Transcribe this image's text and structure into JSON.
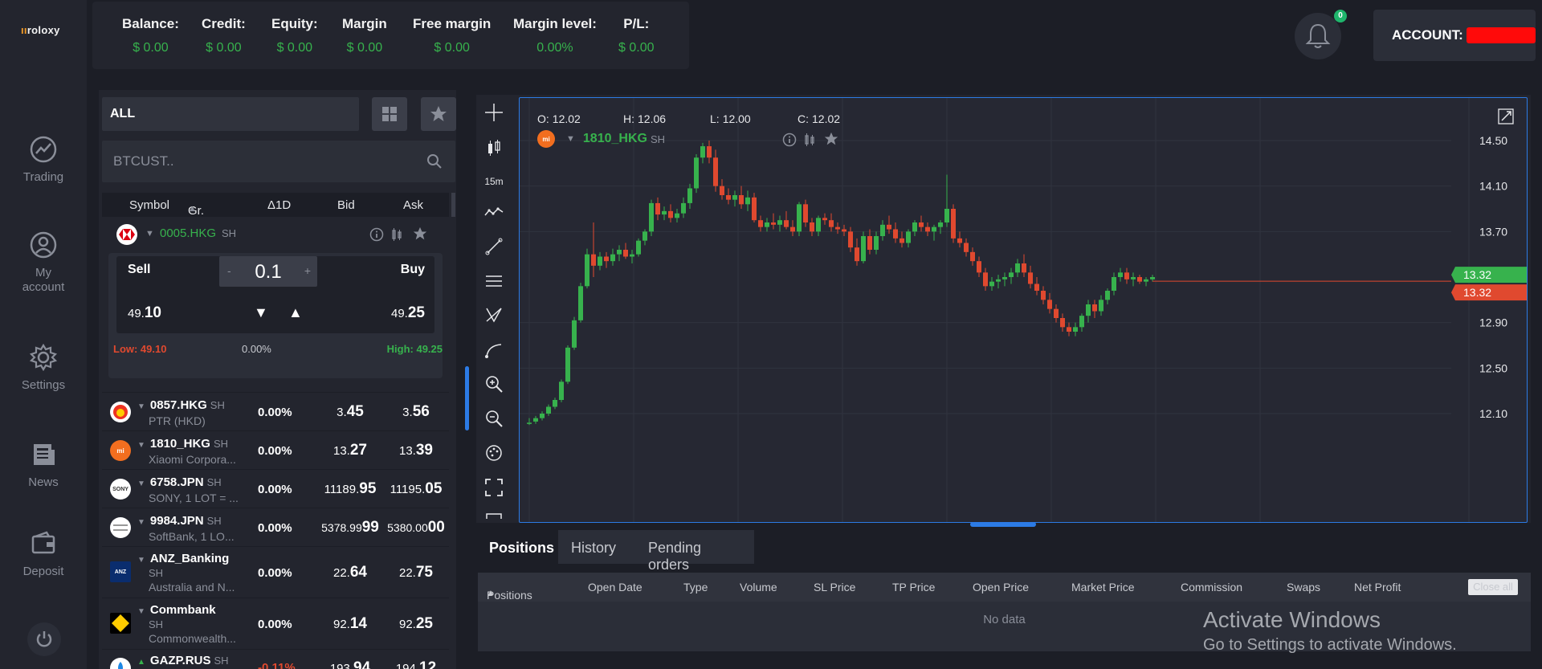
{
  "app": {
    "logo_text": "roloxy"
  },
  "nav": [
    {
      "label": "Trading",
      "icon": "trading-icon"
    },
    {
      "label": "My account",
      "icon": "user-icon"
    },
    {
      "label": "Settings",
      "icon": "gear-icon"
    },
    {
      "label": "News",
      "icon": "news-icon"
    },
    {
      "label": "Deposit",
      "icon": "wallet-icon"
    }
  ],
  "stats": [
    {
      "label": "Balance:",
      "value": "$ 0.00"
    },
    {
      "label": "Credit:",
      "value": "$ 0.00"
    },
    {
      "label": "Equity:",
      "value": "$ 0.00"
    },
    {
      "label": "Margin",
      "value": "$ 0.00"
    },
    {
      "label": "Free margin",
      "value": "$ 0.00"
    },
    {
      "label": "Margin level:",
      "value": "0.00%"
    },
    {
      "label": "P/L:",
      "value": "$ 0.00"
    }
  ],
  "notifications": {
    "count": "0"
  },
  "account": {
    "label": "ACCOUNT:"
  },
  "watchlist": {
    "filter": "ALL",
    "search_placeholder": "BTCUST..",
    "columns": {
      "symbol": "Symbol",
      "group": "Gr.",
      "change": "Δ1D",
      "bid": "Bid",
      "ask": "Ask"
    },
    "expanded": {
      "symbol": "0005.HKG",
      "tag": "SH",
      "sell_label": "Sell",
      "buy_label": "Buy",
      "lot": "0.1",
      "minus": "-",
      "plus": "+",
      "sell_small": "49.",
      "sell_big": "10",
      "buy_small": "49.",
      "buy_big": "25",
      "low": "Low: 49.10",
      "change": "0.00%",
      "high": "High: 49.25"
    },
    "rows": [
      {
        "symbol": "0857.HKG",
        "tag": "SH",
        "desc": "PTR (HKD)",
        "change": "0.00%",
        "bid_small": "3.",
        "bid_big": "45",
        "ask_small": "3.",
        "ask_big": "56",
        "logo": ""
      },
      {
        "symbol": "1810_HKG",
        "tag": "SH",
        "desc": "Xiaomi Corpora...",
        "change": "0.00%",
        "bid_small": "13.",
        "bid_big": "27",
        "ask_small": "13.",
        "ask_big": "39",
        "logo": "mi"
      },
      {
        "symbol": "6758.JPN",
        "tag": "SH",
        "desc": "SONY, 1 LOT = ...",
        "change": "0.00%",
        "bid_small": "11189.",
        "bid_big": "95",
        "ask_small": "11195.",
        "ask_big": "05",
        "logo": "SONY"
      },
      {
        "symbol": "9984.JPN",
        "tag": "SH",
        "desc": "SoftBank, 1 LO...",
        "change": "0.00%",
        "bid_small": "5378.99",
        "bid_big": "99",
        "ask_small": "5380.00",
        "ask_big": "00",
        "logo": ""
      },
      {
        "symbol": "ANZ_Banking",
        "tag": "SH",
        "desc": "Australia and N...",
        "change": "0.00%",
        "bid_small": "22.",
        "bid_big": "64",
        "ask_small": "22.",
        "ask_big": "75",
        "logo": "ANZ"
      },
      {
        "symbol": "Commbank",
        "tag": "SH",
        "desc": "Commonwealth...",
        "change": "0.00%",
        "bid_small": "92.",
        "bid_big": "14",
        "ask_small": "92.",
        "ask_big": "25",
        "logo": ""
      },
      {
        "symbol": "GAZP.RUS",
        "tag": "SH",
        "desc": "",
        "change": "-0.11%",
        "bid_small": "193.",
        "bid_big": "94",
        "ask_small": "194.",
        "ask_big": "12",
        "logo": ""
      }
    ]
  },
  "chart": {
    "ohlc": {
      "o_label": "O:",
      "o": "12.02",
      "h_label": "H:",
      "h": "12.06",
      "l_label": "L:",
      "l": "12.00",
      "c_label": "C:",
      "c": "12.02"
    },
    "symbol": "1810_HKG",
    "tag": "SH",
    "logo": "mi",
    "timeframe": "15m",
    "price_labels": [
      "14.50",
      "14.10",
      "13.70",
      "13.32",
      "13.32",
      "12.90",
      "12.50",
      "12.10"
    ],
    "bid_marker": "13.32",
    "ask_marker": "13.32",
    "colors": {
      "up": "#37b24d",
      "down": "#e0492f",
      "accent": "#2c7be5"
    }
  },
  "chart_data": {
    "type": "candlestick",
    "title": "1810_HKG",
    "ylim": [
      12.0,
      14.6
    ],
    "yticks": [
      12.1,
      12.5,
      12.9,
      13.32,
      13.7,
      14.1,
      14.5
    ],
    "series": [
      {
        "values": [
          [
            12.02,
            12.06,
            12.0,
            12.02
          ],
          [
            12.03,
            12.08,
            12.01,
            12.06
          ],
          [
            12.06,
            12.12,
            12.04,
            12.1
          ],
          [
            12.1,
            12.18,
            12.08,
            12.16
          ],
          [
            12.16,
            12.24,
            12.14,
            12.22
          ],
          [
            12.22,
            12.4,
            12.2,
            12.38
          ],
          [
            12.38,
            12.7,
            12.36,
            12.68
          ],
          [
            12.68,
            12.95,
            12.66,
            12.92
          ],
          [
            12.92,
            13.25,
            12.9,
            13.22
          ],
          [
            13.22,
            13.55,
            13.2,
            13.5
          ],
          [
            13.5,
            13.78,
            13.3,
            13.4
          ],
          [
            13.4,
            13.52,
            13.36,
            13.48
          ],
          [
            13.48,
            13.52,
            13.38,
            13.44
          ],
          [
            13.44,
            13.55,
            13.4,
            13.5
          ],
          [
            13.5,
            13.58,
            13.44,
            13.54
          ],
          [
            13.54,
            13.6,
            13.46,
            13.48
          ],
          [
            13.48,
            13.54,
            13.42,
            13.5
          ],
          [
            13.5,
            13.64,
            13.48,
            13.62
          ],
          [
            13.62,
            13.72,
            13.58,
            13.7
          ],
          [
            13.7,
            13.98,
            13.66,
            13.95
          ],
          [
            13.95,
            14.0,
            13.8,
            13.85
          ],
          [
            13.85,
            13.92,
            13.8,
            13.88
          ],
          [
            13.88,
            13.94,
            13.78,
            13.82
          ],
          [
            13.82,
            13.9,
            13.78,
            13.86
          ],
          [
            13.86,
            14.0,
            13.82,
            13.95
          ],
          [
            13.95,
            14.12,
            13.9,
            14.08
          ],
          [
            14.08,
            14.38,
            14.04,
            14.35
          ],
          [
            14.35,
            14.48,
            14.3,
            14.45
          ],
          [
            14.45,
            14.5,
            14.3,
            14.35
          ],
          [
            14.35,
            14.42,
            14.05,
            14.1
          ],
          [
            14.1,
            14.16,
            13.98,
            14.02
          ],
          [
            14.02,
            14.08,
            13.94,
            13.98
          ],
          [
            13.98,
            14.06,
            13.92,
            14.02
          ],
          [
            14.02,
            14.1,
            13.9,
            13.94
          ],
          [
            13.94,
            14.06,
            13.88,
            14.0
          ],
          [
            14.0,
            14.04,
            13.78,
            13.8
          ],
          [
            13.8,
            13.84,
            13.7,
            13.74
          ],
          [
            13.74,
            13.82,
            13.7,
            13.78
          ],
          [
            13.78,
            13.86,
            13.72,
            13.76
          ],
          [
            13.76,
            13.84,
            13.7,
            13.8
          ],
          [
            13.8,
            13.88,
            13.72,
            13.74
          ],
          [
            13.74,
            13.8,
            13.66,
            13.7
          ],
          [
            13.7,
            13.96,
            13.66,
            13.94
          ],
          [
            13.94,
            13.98,
            13.74,
            13.78
          ],
          [
            13.78,
            13.82,
            13.66,
            13.7
          ],
          [
            13.7,
            13.84,
            13.66,
            13.82
          ],
          [
            13.82,
            13.86,
            13.76,
            13.8
          ],
          [
            13.8,
            13.86,
            13.7,
            13.74
          ],
          [
            13.74,
            13.78,
            13.68,
            13.72
          ],
          [
            13.72,
            13.76,
            13.66,
            13.7
          ],
          [
            13.7,
            13.74,
            13.52,
            13.56
          ],
          [
            13.56,
            13.64,
            13.4,
            13.44
          ],
          [
            13.44,
            13.7,
            13.42,
            13.66
          ],
          [
            13.66,
            13.72,
            13.5,
            13.54
          ],
          [
            13.54,
            13.7,
            13.5,
            13.66
          ],
          [
            13.66,
            13.8,
            13.62,
            13.76
          ],
          [
            13.76,
            13.84,
            13.68,
            13.72
          ],
          [
            13.72,
            13.78,
            13.6,
            13.64
          ],
          [
            13.64,
            13.7,
            13.56,
            13.6
          ],
          [
            13.6,
            13.72,
            13.56,
            13.7
          ],
          [
            13.7,
            13.8,
            13.66,
            13.78
          ],
          [
            13.78,
            13.84,
            13.7,
            13.74
          ],
          [
            13.74,
            13.78,
            13.66,
            13.7
          ],
          [
            13.7,
            13.76,
            13.62,
            13.74
          ],
          [
            13.74,
            13.8,
            13.68,
            13.78
          ],
          [
            13.78,
            14.2,
            13.74,
            13.9
          ],
          [
            13.9,
            13.94,
            13.6,
            13.64
          ],
          [
            13.64,
            13.7,
            13.56,
            13.6
          ],
          [
            13.6,
            13.64,
            13.48,
            13.52
          ],
          [
            13.52,
            13.56,
            13.4,
            13.44
          ],
          [
            13.44,
            13.48,
            13.3,
            13.34
          ],
          [
            13.34,
            13.38,
            13.18,
            13.22
          ],
          [
            13.22,
            13.3,
            13.18,
            13.26
          ],
          [
            13.26,
            13.32,
            13.2,
            13.28
          ],
          [
            13.28,
            13.34,
            13.22,
            13.3
          ],
          [
            13.3,
            13.38,
            13.24,
            13.34
          ],
          [
            13.34,
            13.46,
            13.3,
            13.42
          ],
          [
            13.42,
            13.5,
            13.3,
            13.34
          ],
          [
            13.34,
            13.4,
            13.2,
            13.24
          ],
          [
            13.24,
            13.3,
            13.14,
            13.18
          ],
          [
            13.18,
            13.22,
            13.06,
            13.1
          ],
          [
            13.1,
            13.16,
            12.98,
            13.02
          ],
          [
            13.02,
            13.06,
            12.9,
            12.94
          ],
          [
            12.94,
            12.98,
            12.82,
            12.86
          ],
          [
            12.86,
            12.9,
            12.78,
            12.82
          ],
          [
            12.82,
            12.9,
            12.78,
            12.86
          ],
          [
            12.86,
            12.98,
            12.82,
            12.96
          ],
          [
            12.96,
            13.1,
            12.9,
            13.06
          ],
          [
            13.06,
            13.1,
            12.94,
            13.0
          ],
          [
            13.0,
            13.14,
            12.96,
            13.1
          ],
          [
            13.1,
            13.2,
            13.06,
            13.18
          ],
          [
            13.18,
            13.34,
            13.14,
            13.3
          ],
          [
            13.3,
            13.38,
            13.26,
            13.34
          ],
          [
            13.34,
            13.38,
            13.24,
            13.28
          ],
          [
            13.28,
            13.34,
            13.22,
            13.3
          ],
          [
            13.3,
            13.32,
            13.24,
            13.26
          ],
          [
            13.26,
            13.3,
            13.22,
            13.28
          ],
          [
            13.28,
            13.32,
            13.26,
            13.3
          ]
        ]
      }
    ]
  },
  "bottom": {
    "tabs": [
      "Positions",
      "History",
      "Pending orders"
    ],
    "columns": [
      "Positions",
      "Open Date",
      "Type",
      "Volume",
      "SL Price",
      "TP Price",
      "Open Price",
      "Market Price",
      "Commission",
      "Swaps",
      "Net Profit"
    ],
    "close_all": "Close all",
    "no_data": "No data"
  },
  "watermark": {
    "title": "Activate Windows",
    "subtitle": "Go to Settings to activate Windows."
  }
}
